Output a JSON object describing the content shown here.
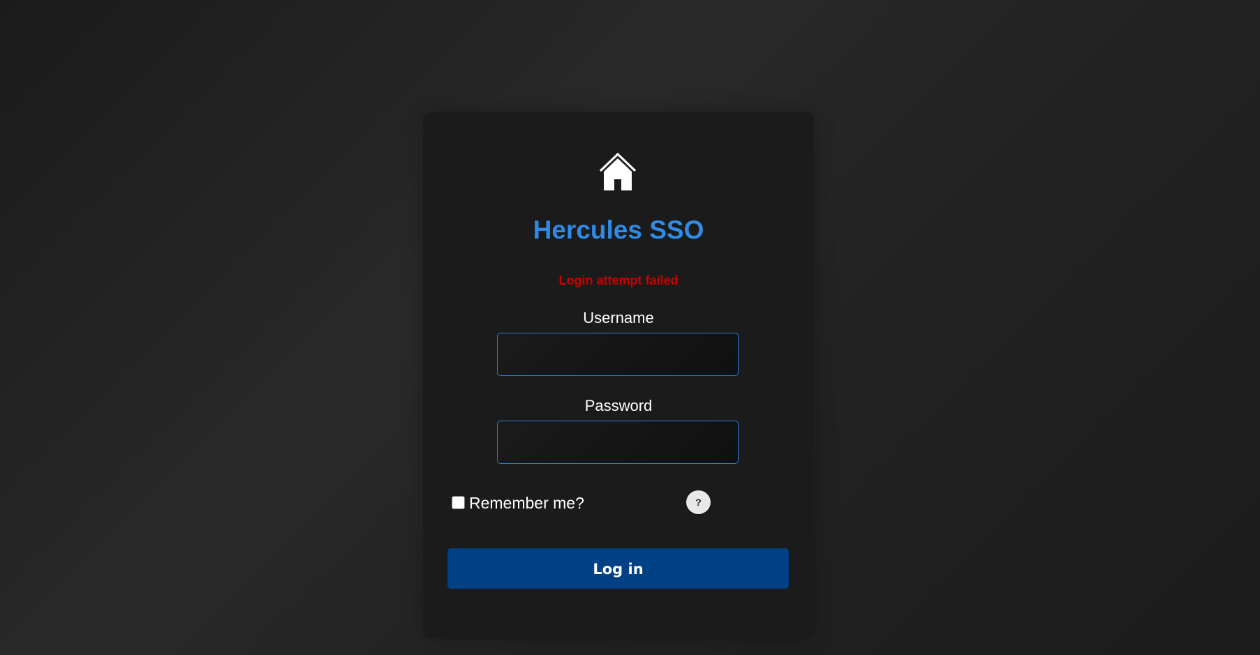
{
  "app": {
    "title": "Hercules SSO",
    "logo_icon": "home-icon"
  },
  "form": {
    "error_message": "Login attempt failed",
    "username": {
      "label": "Username",
      "value": "",
      "placeholder": ""
    },
    "password": {
      "label": "Password",
      "value": "",
      "placeholder": ""
    },
    "remember_me": {
      "label": "Remember me?",
      "checked": false
    },
    "help": {
      "label": "?"
    },
    "submit_label": "Log in"
  },
  "colors": {
    "title": "#2f8be6",
    "error": "#cc0000",
    "primary_button": "#004085",
    "input_border": "#2a7ae2",
    "card_background": "#1b1b1b"
  }
}
